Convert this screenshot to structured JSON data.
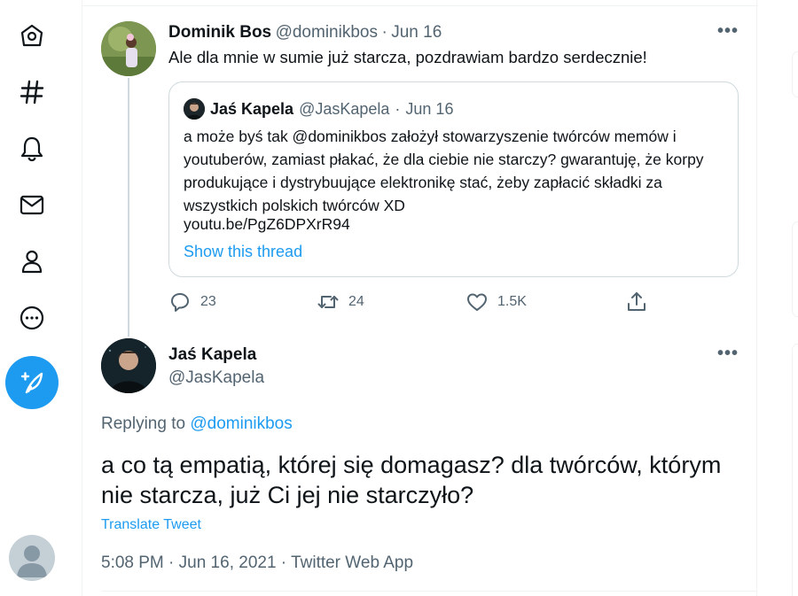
{
  "nav": {
    "items": [
      {
        "icon": "home-icon"
      },
      {
        "icon": "explore-hashtag-icon"
      },
      {
        "icon": "notifications-bell-icon"
      },
      {
        "icon": "messages-envelope-icon"
      },
      {
        "icon": "profile-person-icon"
      },
      {
        "icon": "more-circle-icon"
      }
    ],
    "compose_icon": "compose-feather-icon"
  },
  "parent_tweet": {
    "name": "Dominik Bos",
    "handle": "@dominikbos",
    "separator": "·",
    "date": "Jun 16",
    "text": "Ale dla mnie w sumie już starcza, pozdrawiam bardzo serdecznie!",
    "quote": {
      "name": "Jaś Kapela",
      "handle": "@JasKapela",
      "separator": "·",
      "date": "Jun 16",
      "text": "a może byś tak @dominikbos założył stowarzyszenie twórców memów i youtuberów, zamiast płakać, że dla ciebie nie starczy? gwarantuję, że korpy produkujące i dystrybuujące elektronikę stać, żeby zapłacić składki za wszystkich polskich twórców XD",
      "link": "youtu.be/PgZ6DPXrR94",
      "show_thread": "Show this thread"
    },
    "actions": {
      "replies": "23",
      "retweets": "24",
      "likes": "1.5K"
    }
  },
  "main_tweet": {
    "name": "Jaś Kapela",
    "handle": "@JasKapela",
    "replying_prefix": "Replying to",
    "replying_to": "@dominikbos",
    "text": "a co tą empatią, której się domagasz? dla twórców, którym nie starcza, już Ci jej nie starczyło?",
    "translate": "Translate Tweet",
    "timestamp": "5:08 PM · Jun 16, 2021",
    "meta_separator": "·",
    "source": "Twitter Web App"
  },
  "colors": {
    "accent": "#1d9bf0",
    "text_primary": "#0f1419",
    "text_secondary": "#536471",
    "border": "#cfd9de"
  }
}
